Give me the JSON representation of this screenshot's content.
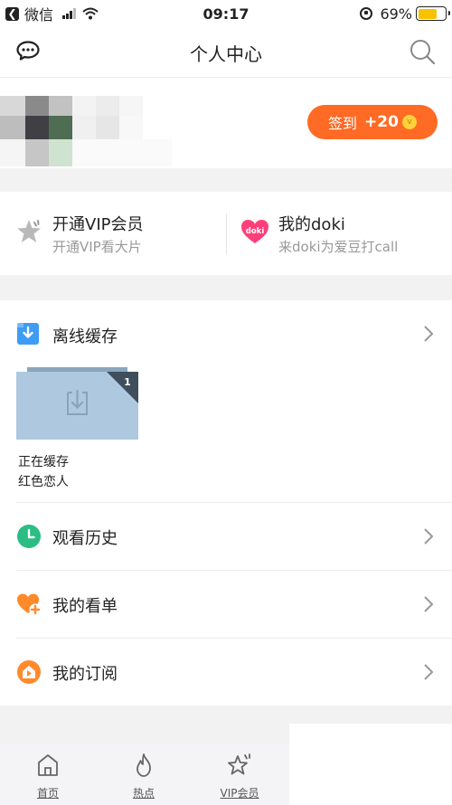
{
  "status_bar": {
    "back_app": "微信",
    "time": "09:17",
    "battery": "69%",
    "battery_level": 0.69
  },
  "header": {
    "title": "个人中心",
    "left_icon": "message-icon",
    "right_icon": "search-icon"
  },
  "profile": {
    "signin_label": "签到",
    "signin_bonus": "+20"
  },
  "vip": {
    "title": "开通VIP会员",
    "subtitle": "开通VIP看大片"
  },
  "doki": {
    "title": "我的doki",
    "subtitle": "来doki为爱豆打call",
    "logo_text": "doki"
  },
  "offline": {
    "label": "离线缓存",
    "badge": "1",
    "status": "正在缓存",
    "title": "红色恋人"
  },
  "menu": {
    "history": "观看历史",
    "watchlist": "我的看单",
    "subscriptions": "我的订阅"
  },
  "tabs": [
    {
      "label": "首页",
      "icon": "home-icon"
    },
    {
      "label": "热点",
      "icon": "flame-icon"
    },
    {
      "label": "VIP会员",
      "icon": "vip-star-icon"
    }
  ],
  "colors": {
    "accent": "#ff6a24",
    "blue": "#3d9cf4",
    "green": "#2bbd83",
    "orange": "#ff8a2a",
    "doki_pink": "#ff3f7a"
  }
}
